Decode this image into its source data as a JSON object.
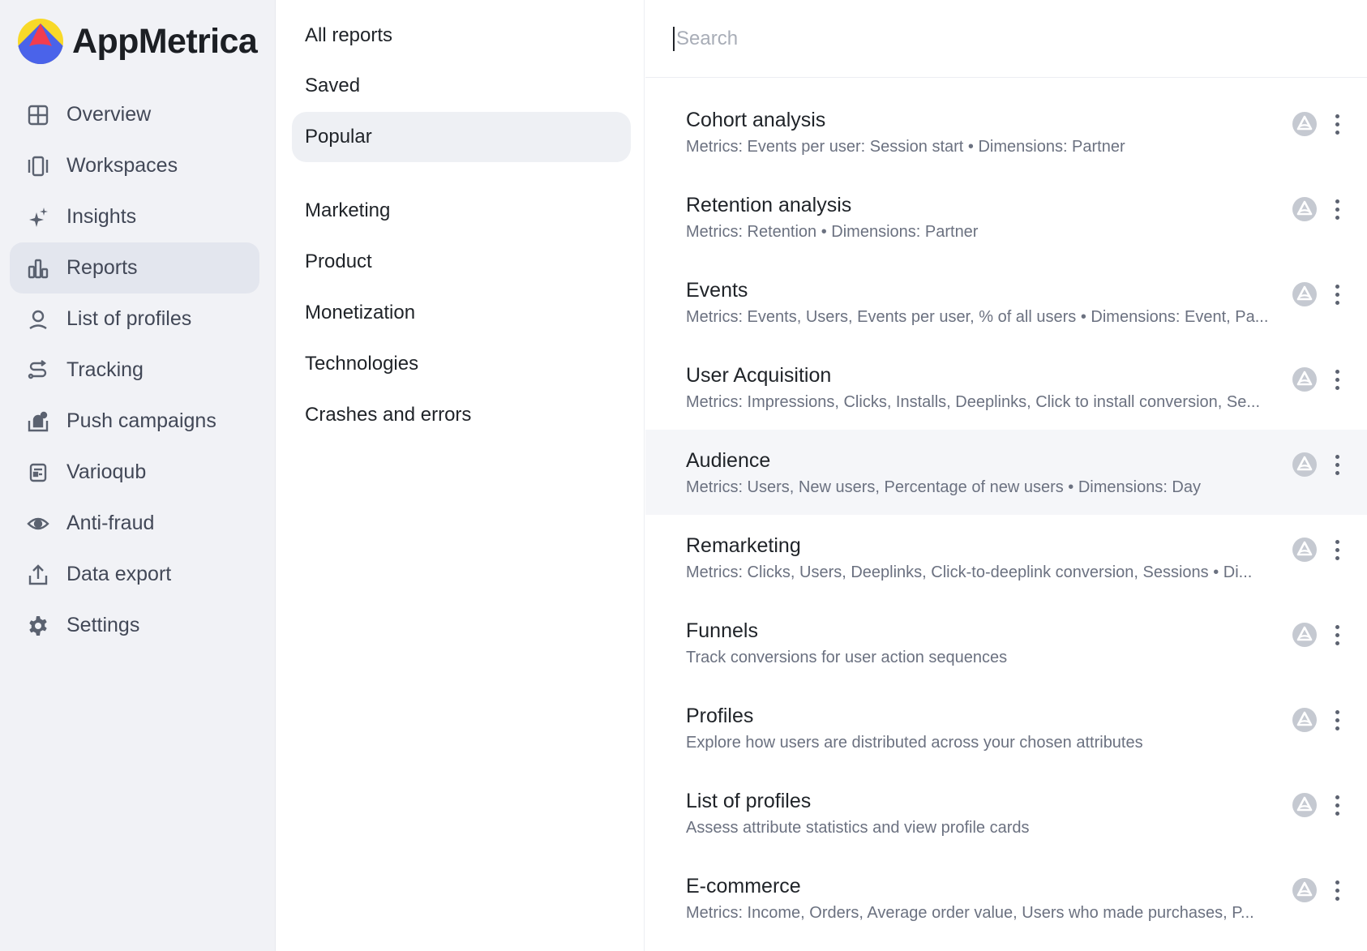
{
  "app": {
    "name": "AppMetrica",
    "logo_colors": {
      "yellow": "#f8d928",
      "red": "#f23d4f",
      "blue": "#4a63ea"
    }
  },
  "sidebar": {
    "items": [
      {
        "label": "Overview",
        "icon": "grid-icon",
        "active": false
      },
      {
        "label": "Workspaces",
        "icon": "workspaces-icon",
        "active": false
      },
      {
        "label": "Insights",
        "icon": "sparkles-icon",
        "active": false
      },
      {
        "label": "Reports",
        "icon": "bar-chart-icon",
        "active": true
      },
      {
        "label": "List of profiles",
        "icon": "person-icon",
        "active": false
      },
      {
        "label": "Tracking",
        "icon": "route-icon",
        "active": false
      },
      {
        "label": "Push campaigns",
        "icon": "push-bell-icon",
        "active": false
      },
      {
        "label": "Varioqub",
        "icon": "experiment-icon",
        "active": false
      },
      {
        "label": "Anti-fraud",
        "icon": "eye-icon",
        "active": false
      },
      {
        "label": "Data export",
        "icon": "upload-icon",
        "active": false
      },
      {
        "label": "Settings",
        "icon": "gear-icon",
        "active": false
      }
    ]
  },
  "categories": {
    "items": [
      {
        "label": "All reports",
        "active": false
      },
      {
        "label": "Saved",
        "active": false
      },
      {
        "label": "Popular",
        "active": true
      },
      {
        "label": "Marketing",
        "active": false
      },
      {
        "label": "Product",
        "active": false
      },
      {
        "label": "Monetization",
        "active": false
      },
      {
        "label": "Technologies",
        "active": false
      },
      {
        "label": "Crashes and errors",
        "active": false
      }
    ]
  },
  "search": {
    "placeholder": "Search",
    "value": ""
  },
  "reports": [
    {
      "title": "Cohort analysis",
      "description": "Metrics: Events per user: Session start • Dimensions: Partner"
    },
    {
      "title": "Retention analysis",
      "description": "Metrics: Retention • Dimensions: Partner"
    },
    {
      "title": "Events",
      "description": "Metrics: Events, Users, Events per user, % of all users • Dimensions: Event, Pa..."
    },
    {
      "title": "User Acquisition",
      "description": "Metrics: Impressions, Clicks, Installs, Deeplinks, Click to install conversion, Se..."
    },
    {
      "title": "Audience",
      "description": "Metrics: Users, New users, Percentage of new users • Dimensions: Day",
      "hover": true
    },
    {
      "title": "Remarketing",
      "description": "Metrics: Clicks, Users, Deeplinks, Click-to-deeplink conversion, Sessions • Di..."
    },
    {
      "title": "Funnels",
      "description": "Track conversions for user action sequences"
    },
    {
      "title": "Profiles",
      "description": "Explore how users are distributed across your chosen attributes"
    },
    {
      "title": "List of profiles",
      "description": "Assess attribute statistics and view profile cards"
    },
    {
      "title": "E-commerce",
      "description": "Metrics: Income, Orders, Average order value, Users who made purchases, P..."
    }
  ],
  "report_badge_icon": "appmetrica-badge-icon",
  "report_menu_icon": "more-vertical-icon"
}
